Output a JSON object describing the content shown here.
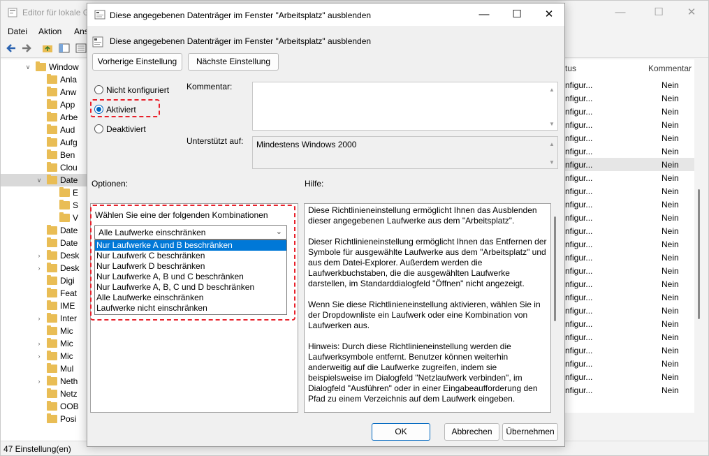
{
  "background_window": {
    "title": "Editor für lokale G",
    "menu": [
      "Datei",
      "Aktion",
      "Ans"
    ],
    "tree_items": [
      {
        "label": "Window",
        "expander": "open",
        "level": 0
      },
      {
        "label": "Anla",
        "level": 1
      },
      {
        "label": "Anw",
        "level": 1
      },
      {
        "label": "App",
        "level": 1
      },
      {
        "label": "Arbe",
        "level": 1
      },
      {
        "label": "Aud",
        "level": 1
      },
      {
        "label": "Aufg",
        "level": 1
      },
      {
        "label": "Ben",
        "level": 1
      },
      {
        "label": "Clou",
        "level": 1
      },
      {
        "label": "Date",
        "expander": "open",
        "level": 1,
        "selected": true
      },
      {
        "label": "E",
        "level": 2
      },
      {
        "label": "S",
        "level": 2
      },
      {
        "label": "V",
        "level": 2
      },
      {
        "label": "Date",
        "level": 1
      },
      {
        "label": "Date",
        "level": 1
      },
      {
        "label": "Desk",
        "expander": "closed",
        "level": 1
      },
      {
        "label": "Desk",
        "expander": "closed",
        "level": 1
      },
      {
        "label": "Digi",
        "level": 1
      },
      {
        "label": "Feat",
        "level": 1
      },
      {
        "label": "IME",
        "level": 1
      },
      {
        "label": "Inter",
        "expander": "closed",
        "level": 1
      },
      {
        "label": "Mic",
        "level": 1
      },
      {
        "label": "Mic",
        "expander": "closed",
        "level": 1
      },
      {
        "label": "Mic",
        "expander": "closed",
        "level": 1
      },
      {
        "label": "Mul",
        "level": 1
      },
      {
        "label": "Neth",
        "expander": "closed",
        "level": 1
      },
      {
        "label": "Netz",
        "level": 1
      },
      {
        "label": "OOB",
        "level": 1
      },
      {
        "label": "Posi",
        "level": 1
      }
    ],
    "list_header": {
      "status": "tus",
      "comment": "Kommentar"
    },
    "list_rows": [
      {
        "status": "nfigur...",
        "comment": "Nein"
      },
      {
        "status": "nfigur...",
        "comment": "Nein"
      },
      {
        "status": "nfigur...",
        "comment": "Nein"
      },
      {
        "status": "nfigur...",
        "comment": "Nein"
      },
      {
        "status": "nfigur...",
        "comment": "Nein"
      },
      {
        "status": "nfigur...",
        "comment": "Nein"
      },
      {
        "status": "nfigur...",
        "comment": "Nein",
        "highlighted": true
      },
      {
        "status": "nfigur...",
        "comment": "Nein"
      },
      {
        "status": "nfigur...",
        "comment": "Nein"
      },
      {
        "status": "nfigur...",
        "comment": "Nein"
      },
      {
        "status": "nfigur...",
        "comment": "Nein"
      },
      {
        "status": "nfigur...",
        "comment": "Nein"
      },
      {
        "status": "nfigur...",
        "comment": "Nein"
      },
      {
        "status": "nfigur...",
        "comment": "Nein"
      },
      {
        "status": "nfigur...",
        "comment": "Nein"
      },
      {
        "status": "nfigur...",
        "comment": "Nein"
      },
      {
        "status": "nfigur...",
        "comment": "Nein"
      },
      {
        "status": "nfigur...",
        "comment": "Nein"
      },
      {
        "status": "nfigur...",
        "comment": "Nein"
      },
      {
        "status": "nfigur...",
        "comment": "Nein"
      },
      {
        "status": "nfigur...",
        "comment": "Nein"
      },
      {
        "status": "nfigur...",
        "comment": "Nein"
      },
      {
        "status": "nfigur...",
        "comment": "Nein"
      },
      {
        "status": "nfigur...",
        "comment": "Nein"
      }
    ],
    "status_bar": "47 Einstellung(en)"
  },
  "dialog": {
    "title": "Diese angegebenen Datenträger im Fenster \"Arbeitsplatz\" ausblenden",
    "header": "Diese angegebenen Datenträger im Fenster \"Arbeitsplatz\" ausblenden",
    "prev_button": "Vorherige Einstellung",
    "next_button": "Nächste Einstellung",
    "radio_options": [
      {
        "label": "Nicht konfiguriert",
        "checked": false
      },
      {
        "label": "Aktiviert",
        "checked": true
      },
      {
        "label": "Deaktiviert",
        "checked": false
      }
    ],
    "comment_label": "Kommentar:",
    "comment_value": "",
    "supported_label": "Unterstützt auf:",
    "supported_value": "Mindestens Windows 2000",
    "options_label": "Optionen:",
    "help_label": "Hilfe:",
    "options": {
      "combo_label": "Wählen Sie eine der folgenden Kombinationen",
      "combo_value": "Alle Laufwerke einschränken",
      "dropdown_items": [
        "Nur Laufwerke A und B beschränken",
        "Nur Laufwerk C beschränken",
        "Nur Laufwerk D beschränken",
        "Nur Laufwerke A, B und C beschränken",
        "Nur Laufwerke A, B, C und D beschränken",
        "Alle Laufwerke einschränken",
        "Laufwerke nicht einschränken"
      ],
      "highlighted_index": 0
    },
    "help_paragraphs": [
      "Diese Richtlinieneinstellung ermöglicht Ihnen das Ausblenden dieser angegebenen Laufwerke aus dem \"Arbeitsplatz\".",
      "Dieser Richtlinieneinstellung ermöglicht Ihnen das Entfernen der Symbole für ausgewählte Laufwerke aus dem \"Arbeitsplatz\" und aus dem Datei-Explorer. Außerdem werden die Laufwerkbuchstaben, die die ausgewählten Laufwerke darstellen, im Standarddialogfeld \"Öffnen\" nicht angezeigt.",
      "Wenn Sie diese Richtlinieneinstellung aktivieren, wählen Sie in der Dropdownliste ein Laufwerk oder eine Kombination von Laufwerken aus.",
      "Hinweis: Durch diese Richtlinieneinstellung werden die Laufwerksymbole entfernt. Benutzer können weiterhin anderweitig auf die Laufwerke zugreifen, indem sie beispielsweise im Dialogfeld \"Netzlaufwerk verbinden\", im Dialogfeld \"Ausführen\" oder in einer Eingabeaufforderung den Pfad zu einem Verzeichnis auf dem Laufwerk eingeben."
    ],
    "ok_button": "OK",
    "cancel_button": "Abbrechen",
    "apply_button": "Übernehmen"
  },
  "colors": {
    "accent": "#0067c0",
    "highlight": "#e8202a",
    "selection": "#0078d7",
    "folder": "#e9bd55"
  }
}
